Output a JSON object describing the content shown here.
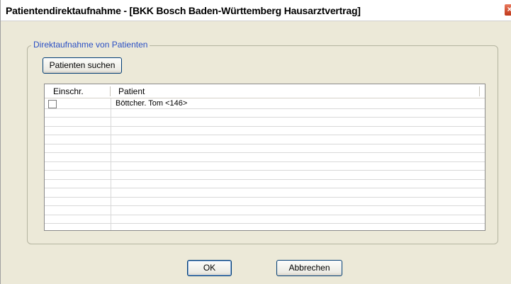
{
  "window": {
    "title": "Patientendirektaufnahme - [BKK Bosch Baden-Württemberg Hausarztvertrag]",
    "close_glyph": "×"
  },
  "group": {
    "legend": "Direktaufnahme von Patienten"
  },
  "buttons": {
    "search_label": "Patienten suchen",
    "ok_label": "OK",
    "cancel_label": "Abbrechen"
  },
  "table": {
    "columns": [
      "Einschr.",
      "Patient"
    ],
    "rows": [
      {
        "checked": false,
        "patient": "Böttcher. Tom <146>"
      },
      {
        "checked": false,
        "patient": ""
      },
      {
        "checked": false,
        "patient": ""
      },
      {
        "checked": false,
        "patient": ""
      },
      {
        "checked": false,
        "patient": ""
      },
      {
        "checked": false,
        "patient": ""
      },
      {
        "checked": false,
        "patient": ""
      },
      {
        "checked": false,
        "patient": ""
      },
      {
        "checked": false,
        "patient": ""
      },
      {
        "checked": false,
        "patient": ""
      },
      {
        "checked": false,
        "patient": ""
      },
      {
        "checked": false,
        "patient": ""
      },
      {
        "checked": false,
        "patient": ""
      },
      {
        "checked": false,
        "patient": ""
      }
    ]
  },
  "colors": {
    "window_bg": "#ece9d8",
    "legend_text": "#2a4fc4",
    "button_border": "#003c74",
    "close_button": "#c0391b"
  }
}
